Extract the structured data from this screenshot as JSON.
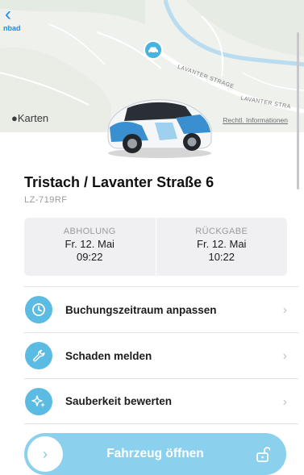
{
  "nav": {
    "back_label": "nbad"
  },
  "map": {
    "attribution": "Karten",
    "legal_link": "Rechtl. Informationen",
    "street_1": "LAVANTER STRAGE",
    "street_2": "LAVANTER STRA"
  },
  "vehicle": {
    "location": "Tristach / Lavanter Straße 6",
    "plate": "LZ-719RF"
  },
  "times": {
    "pickup": {
      "label": "ABHOLUNG",
      "date": "Fr. 12. Mai",
      "time": "09:22"
    },
    "return": {
      "label": "RÜCKGABE",
      "date": "Fr. 12. Mai",
      "time": "10:22"
    }
  },
  "actions": [
    {
      "label": "Buchungszeitraum anpassen",
      "icon": "clock-icon"
    },
    {
      "label": "Schaden melden",
      "icon": "wrench-icon"
    },
    {
      "label": "Sauberkeit bewerten",
      "icon": "sparkle-icon"
    }
  ],
  "open_button": {
    "label": "Fahrzeug öffnen",
    "icon": "unlock-icon"
  },
  "colors": {
    "accent": "#5bbbe3",
    "open_button": "#8bd1ee",
    "link": "#1e8cf2"
  }
}
